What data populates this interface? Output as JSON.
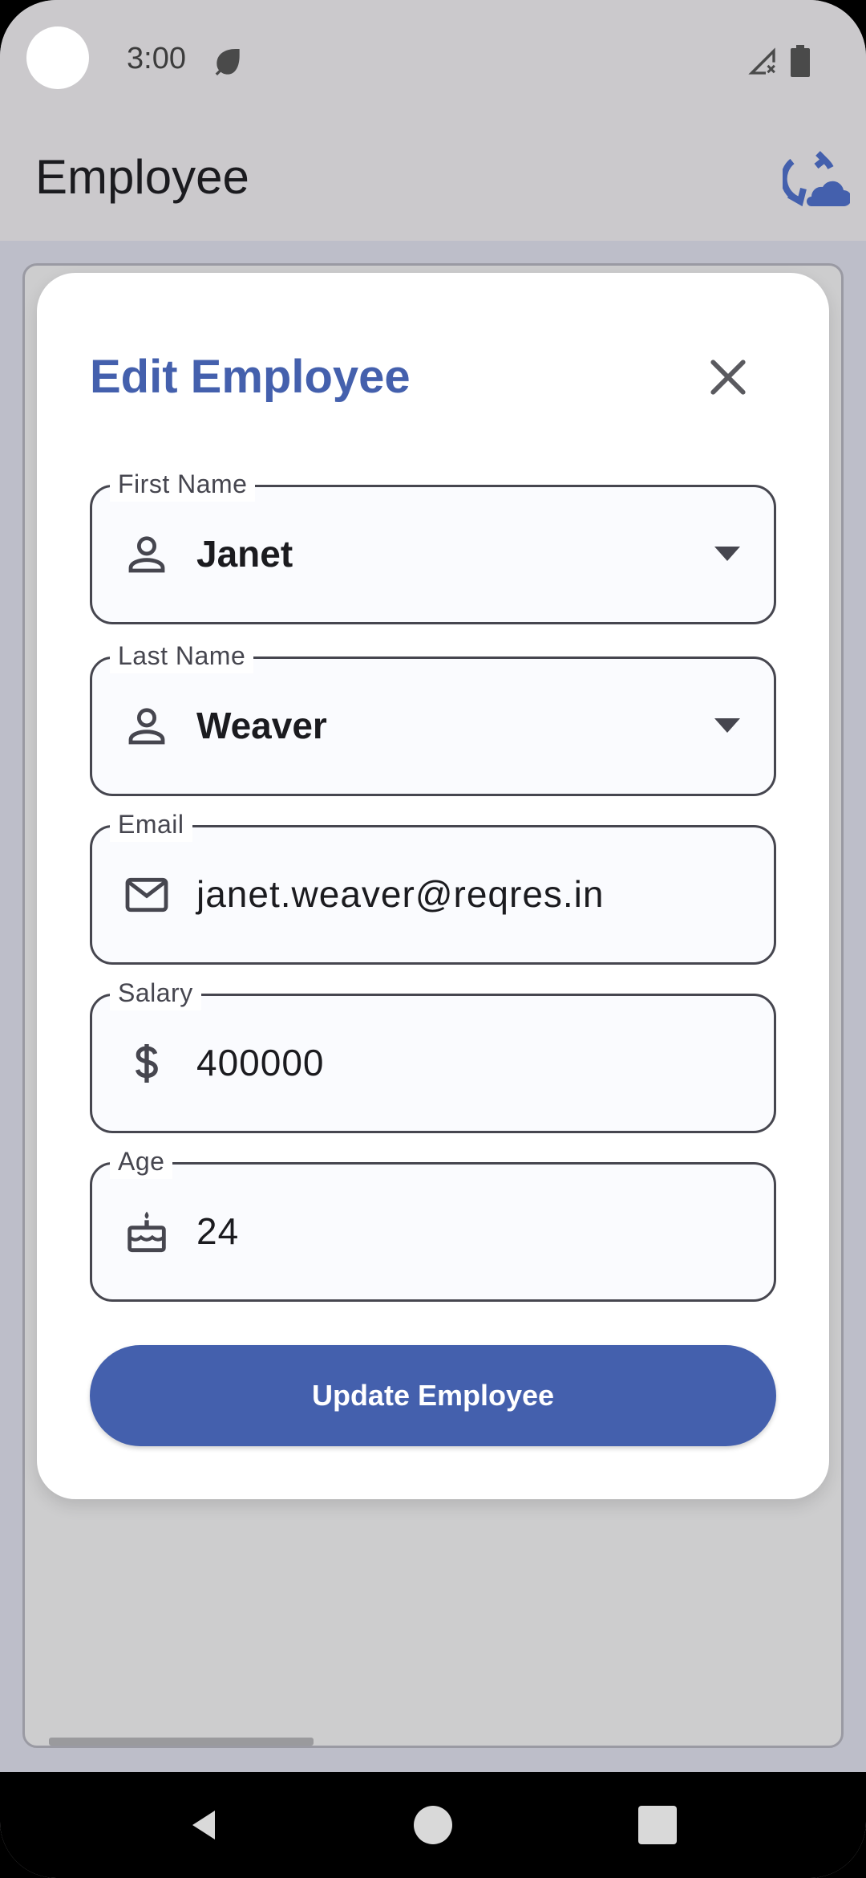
{
  "status_bar": {
    "time": "3:00"
  },
  "app_bar": {
    "title": "Employee"
  },
  "dialog": {
    "title": "Edit Employee",
    "fields": [
      {
        "label": "First Name",
        "value": "Janet",
        "icon": "person-icon",
        "dropdown": true
      },
      {
        "label": "Last Name",
        "value": "Weaver",
        "icon": "person-icon",
        "dropdown": true
      },
      {
        "label": "Email",
        "value": "janet.weaver@reqres.in",
        "icon": "mail-icon",
        "dropdown": false
      },
      {
        "label": "Salary",
        "value": "400000",
        "icon": "dollar-icon",
        "dropdown": false
      },
      {
        "label": "Age",
        "value": "24",
        "icon": "cake-icon",
        "dropdown": false
      }
    ],
    "submit_label": "Update Employee"
  },
  "colors": {
    "primary": "#4460AD",
    "surface": "#FFFFFF",
    "appbar": "#CBC9CC",
    "scrim": "#BDBEC9"
  }
}
